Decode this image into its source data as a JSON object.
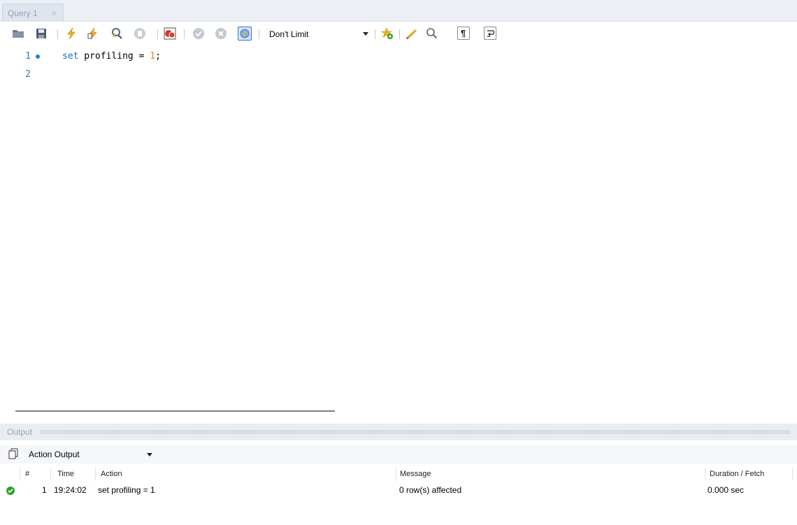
{
  "tab": {
    "label": "Query 1",
    "close": "×"
  },
  "toolbar": {
    "limit_select": "Don't Limit",
    "icons": [
      "open-file-icon",
      "save-icon",
      "execute-icon",
      "execute-current-icon",
      "explain-icon",
      "stop-icon",
      "toggle-error-stop-icon",
      "commit-icon",
      "rollback-icon",
      "autocommit-icon",
      "add-snippet-icon",
      "beautify-icon",
      "find-icon",
      "invisible-chars-icon",
      "wrap-lines-icon"
    ]
  },
  "editor": {
    "lines": [
      {
        "number": "1",
        "keyword": "set",
        "text": " profiling = ",
        "number_literal": "1",
        "end": ";"
      },
      {
        "number": "2"
      }
    ]
  },
  "output": {
    "title": "Output",
    "select_value": "Action Output",
    "columns": {
      "hash": "#",
      "time": "Time",
      "action": "Action",
      "message": "Message",
      "duration": "Duration / Fetch"
    },
    "rows": [
      {
        "status": "success",
        "index": "1",
        "time": "19:24:02",
        "action": "set profiling = 1",
        "message": "0 row(s) affected",
        "duration": "0.000 sec"
      }
    ]
  },
  "colors": {
    "keyword": "#1a6fb8",
    "number": "#d28a16",
    "line_number": "#2b79b8",
    "success": "#2aa42a"
  }
}
